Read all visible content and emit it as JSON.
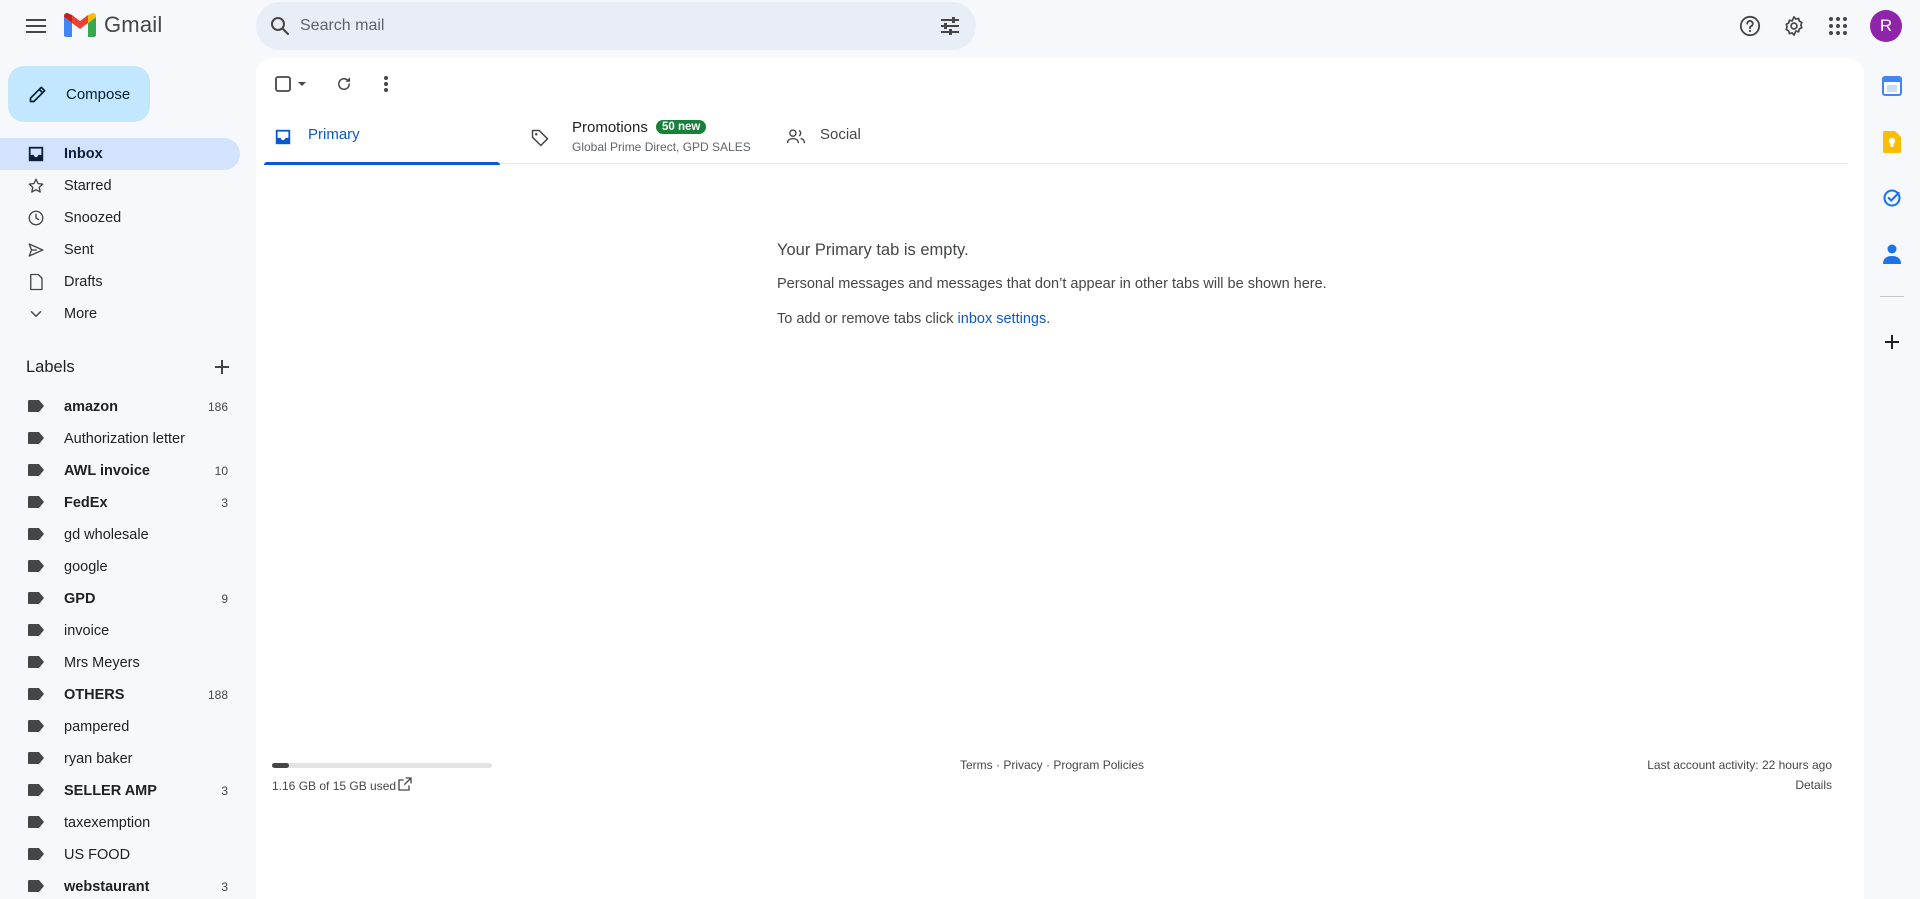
{
  "app": {
    "name": "Gmail",
    "avatar_letter": "R",
    "accent": "#0b57d0",
    "avatar_color": "#8e24aa"
  },
  "search": {
    "placeholder": "Search mail"
  },
  "compose": {
    "label": "Compose"
  },
  "nav": [
    {
      "label": "Inbox",
      "icon": "inbox-icon",
      "active": true
    },
    {
      "label": "Starred",
      "icon": "star-icon"
    },
    {
      "label": "Snoozed",
      "icon": "clock-icon"
    },
    {
      "label": "Sent",
      "icon": "send-icon"
    },
    {
      "label": "Drafts",
      "icon": "draft-icon"
    },
    {
      "label": "More",
      "icon": "chevron-down-icon"
    }
  ],
  "labels": {
    "heading": "Labels",
    "items": [
      {
        "name": "amazon",
        "count": "186",
        "bold": true
      },
      {
        "name": "Authorization letter",
        "count": "",
        "bold": false
      },
      {
        "name": "AWL invoice",
        "count": "10",
        "bold": true
      },
      {
        "name": "FedEx",
        "count": "3",
        "bold": true
      },
      {
        "name": "gd wholesale",
        "count": "",
        "bold": false
      },
      {
        "name": "google",
        "count": "",
        "bold": false
      },
      {
        "name": "GPD",
        "count": "9",
        "bold": true
      },
      {
        "name": "invoice",
        "count": "",
        "bold": false
      },
      {
        "name": "Mrs Meyers",
        "count": "",
        "bold": false
      },
      {
        "name": "OTHERS",
        "count": "188",
        "bold": true
      },
      {
        "name": "pampered",
        "count": "",
        "bold": false
      },
      {
        "name": "ryan baker",
        "count": "",
        "bold": false
      },
      {
        "name": "SELLER AMP",
        "count": "3",
        "bold": true
      },
      {
        "name": "taxexemption",
        "count": "",
        "bold": false
      },
      {
        "name": "US FOOD",
        "count": "",
        "bold": false
      },
      {
        "name": "webstaurant",
        "count": "3",
        "bold": true
      }
    ]
  },
  "tabs": {
    "primary": "Primary",
    "promotions": {
      "label": "Promotions",
      "badge": "50 new",
      "senders": "Global Prime Direct, GPD SALES",
      "badge_color": "#188038"
    },
    "social": "Social"
  },
  "empty_state": {
    "title": "Your Primary tab is empty.",
    "line1": "Personal messages and messages that don’t appear in other tabs will be shown here.",
    "line2_prefix": "To add or remove tabs click ",
    "line2_link": "inbox settings",
    "line2_suffix": "."
  },
  "footer": {
    "storage_text": "1.16 GB of 15 GB used",
    "storage_fraction": 0.077,
    "terms": "Terms",
    "privacy": "Privacy",
    "program_policies": "Program Policies",
    "separator": " · ",
    "last_activity": "Last account activity: 22 hours ago",
    "details": "Details"
  }
}
